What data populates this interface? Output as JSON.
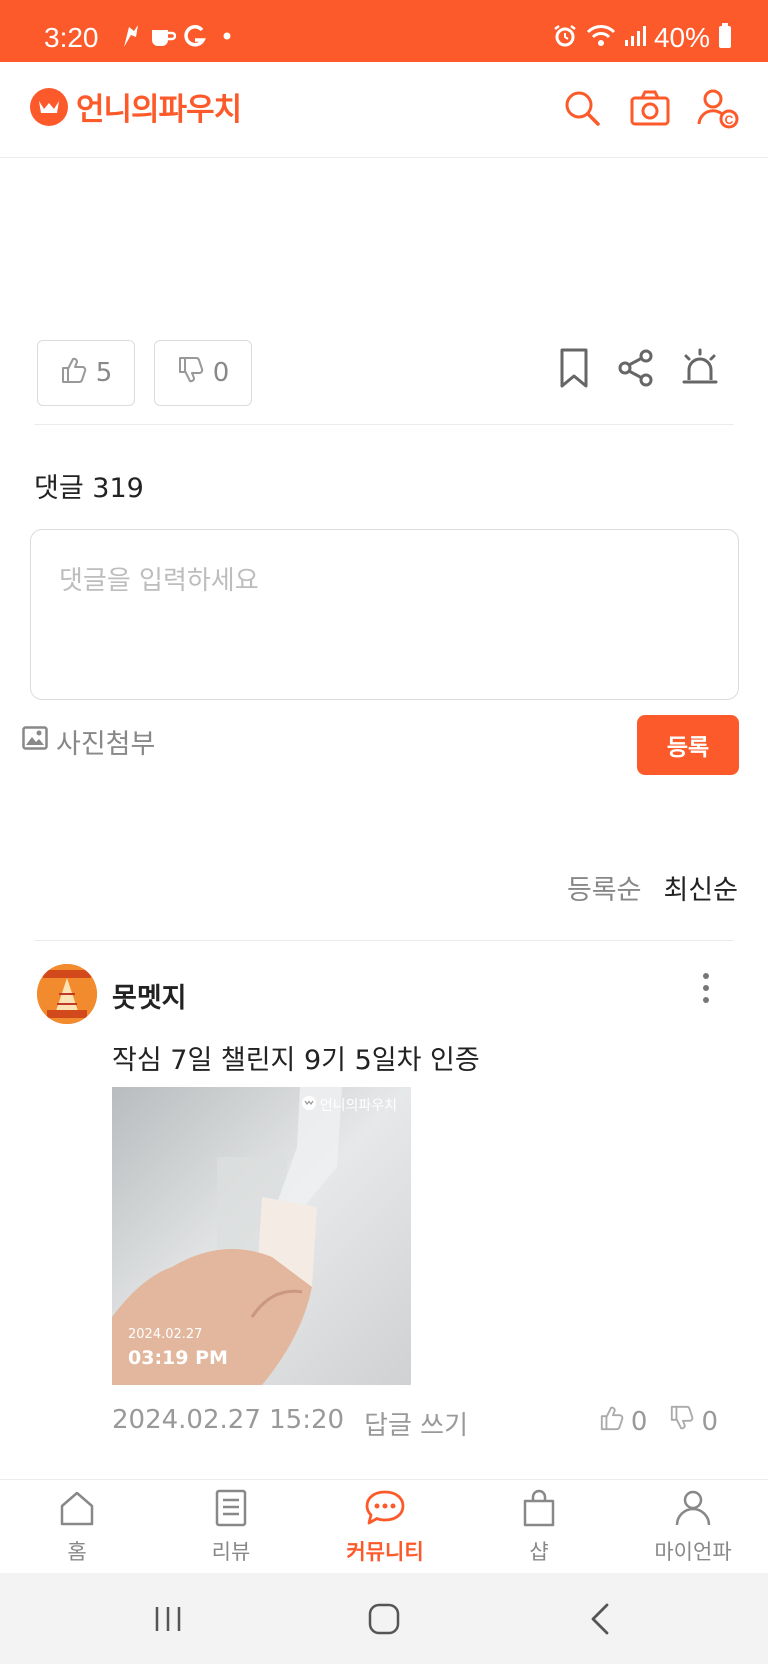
{
  "status_bar": {
    "time": "3:20",
    "battery": "40%"
  },
  "header": {
    "logo_text": "언니의파우치",
    "icons": [
      "search-icon",
      "camera-icon",
      "profile-coin-icon"
    ]
  },
  "post_actions": {
    "like_count": "5",
    "dislike_count": "0",
    "icons": [
      "bookmark-icon",
      "share-icon",
      "report-siren-icon"
    ]
  },
  "comments": {
    "count_label": "댓글 319",
    "input_placeholder": "댓글을 입력하세요",
    "photo_attach_label": "사진첨부",
    "submit_label": "등록",
    "sort_options": [
      "등록순",
      "최신순"
    ]
  },
  "comment_items": [
    {
      "username": "못멧지",
      "text": "작심 7일 챌린지 9기 5일차 인증",
      "photo": {
        "watermark": "언니의파우치",
        "date": "2024.02.27",
        "time": "03:19 PM"
      },
      "timestamp": "2024.02.27 15:20",
      "reply_label": "답글 쓰기",
      "likes": "0",
      "dislikes": "0"
    }
  ],
  "bottom_nav": {
    "items": [
      {
        "label": "홈",
        "icon": "home-icon"
      },
      {
        "label": "리뷰",
        "icon": "review-document-icon"
      },
      {
        "label": "커뮤니티",
        "icon": "community-chat-icon"
      },
      {
        "label": "샵",
        "icon": "shop-bag-icon"
      },
      {
        "label": "마이언파",
        "icon": "my-profile-icon"
      }
    ],
    "active": "커뮤니티"
  },
  "colors": {
    "brand": "#fd5a2b",
    "muted_text": "#888888",
    "border": "#dcdcdc"
  }
}
